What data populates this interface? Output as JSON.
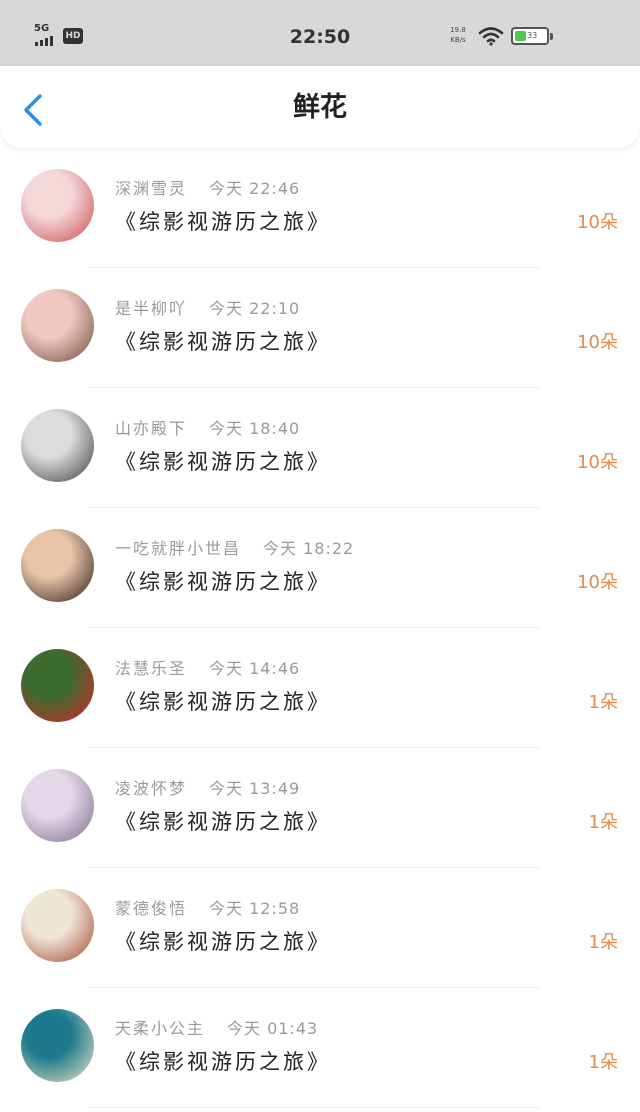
{
  "status_bar": {
    "network": "5G",
    "hd": "HD",
    "time": "22:50",
    "speed_value": "19.8",
    "speed_unit": "KB/s",
    "battery": "33",
    "battery_color": "#4fc64f"
  },
  "header": {
    "title": "鲜花",
    "accent_color": "#2a8de8"
  },
  "entries": [
    {
      "name": "深渊雪灵",
      "time": "今天 22:46",
      "book": "《综影视游历之旅》",
      "count": "10朵",
      "avatar_colors": [
        "#f4d7d9",
        "#c94a4a"
      ]
    },
    {
      "name": "是半柳吖",
      "time": "今天 22:10",
      "book": "《综影视游历之旅》",
      "count": "10朵",
      "avatar_colors": [
        "#f2c9c2",
        "#6b4a3a"
      ]
    },
    {
      "name": "山亦殿下",
      "time": "今天 18:40",
      "book": "《综影视游历之旅》",
      "count": "10朵",
      "avatar_colors": [
        "#dcdcdc",
        "#3b3b3b"
      ]
    },
    {
      "name": "一吃就胖小世昌",
      "time": "今天 18:22",
      "book": "《综影视游历之旅》",
      "count": "10朵",
      "avatar_colors": [
        "#e8c4a8",
        "#2a1a14"
      ]
    },
    {
      "name": "法慧乐圣",
      "time": "今天 14:46",
      "book": "《综影视游历之旅》",
      "count": "1朵",
      "avatar_colors": [
        "#3c6b2e",
        "#d8232a"
      ]
    },
    {
      "name": "凌波怀梦",
      "time": "今天 13:49",
      "book": "《综影视游历之旅》",
      "count": "1朵",
      "avatar_colors": [
        "#e6d6ea",
        "#7a6a8a"
      ]
    },
    {
      "name": "蒙德俊悟",
      "time": "今天 12:58",
      "book": "《综影视游历之旅》",
      "count": "1朵",
      "avatar_colors": [
        "#f0e6d6",
        "#a0452e"
      ]
    },
    {
      "name": "天柔小公主",
      "time": "今天 01:43",
      "book": "《综影视游历之旅》",
      "count": "1朵",
      "avatar_colors": [
        "#1c7a8c",
        "#f3e6c8"
      ]
    }
  ]
}
